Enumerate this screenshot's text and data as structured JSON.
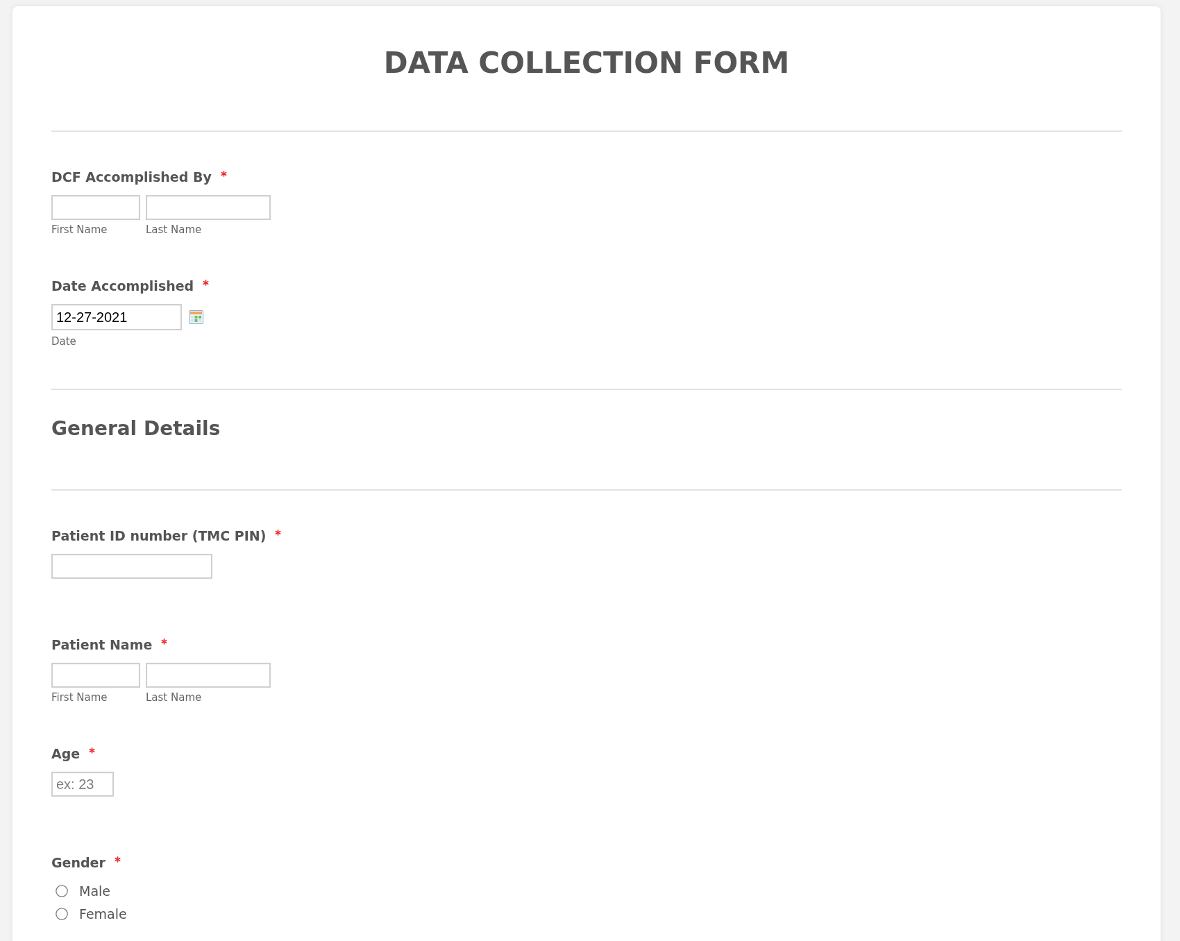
{
  "title": "DATA COLLECTION FORM",
  "fields": [
    {
      "kind": "name",
      "label": "DCF Accomplished By",
      "required": true,
      "subfields": [
        {
          "sublabel": "First Name"
        },
        {
          "sublabel": "Last Name"
        }
      ]
    },
    {
      "kind": "date",
      "label": "Date Accomplished",
      "required": true,
      "subfields": [
        {
          "value": "12-27-2021",
          "sublabel": "Date"
        }
      ]
    },
    {
      "kind": "section",
      "label": "General Details"
    },
    {
      "kind": "text",
      "label": "Patient ID number (TMC PIN)",
      "required": true
    },
    {
      "kind": "name",
      "label": "Patient Name",
      "required": true,
      "subfields": [
        {
          "sublabel": "First Name"
        },
        {
          "sublabel": "Last Name"
        }
      ]
    },
    {
      "kind": "number",
      "label": "Age",
      "required": true,
      "placeholder": "ex: 23"
    },
    {
      "kind": "radio",
      "label": "Gender",
      "required": true,
      "options": [
        {
          "label": "Male",
          "selected": false
        },
        {
          "label": "Female",
          "selected": false
        }
      ]
    }
  ]
}
